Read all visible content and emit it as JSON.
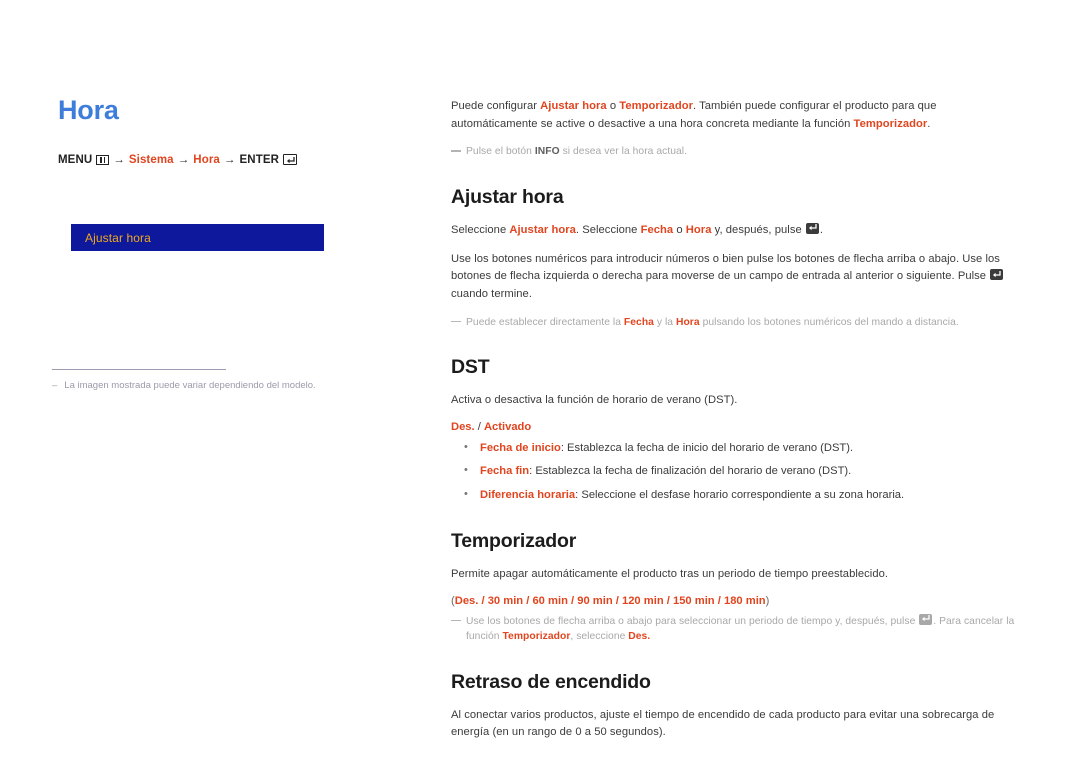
{
  "left": {
    "title": "Hora",
    "menu_path": {
      "menu_label": "MENU",
      "menu_icon": "menu-grid-icon",
      "arrow": "→",
      "step1": "Sistema",
      "step2": "Hora",
      "enter_label": "ENTER",
      "enter_icon": "enter-key-icon"
    },
    "osd_item": "Ajustar hora",
    "footnote_dash": "–",
    "footnote": "La imagen mostrada puede variar dependiendo del modelo."
  },
  "right": {
    "intro": {
      "a": "Puede configurar ",
      "b": "Ajustar hora",
      "c": " o ",
      "d": "Temporizador",
      "e": ". También puede configurar el producto para que automáticamente se active o desactive a una hora concreta mediante la función ",
      "f": "Temporizador",
      "g": "."
    },
    "intro_note": {
      "a": "Pulse el botón ",
      "b": "INFO",
      "c": " si desea ver la hora actual."
    },
    "ajustar_hora": {
      "heading": "Ajustar hora",
      "p1": {
        "a": "Seleccione ",
        "b": "Ajustar hora",
        "c": ". Seleccione ",
        "d": "Fecha",
        "e": " o ",
        "f": "Hora",
        "g": " y, después, pulse ",
        "h": "."
      },
      "p2": "Use los botones numéricos para introducir números o bien pulse los botones de flecha arriba o abajo. Use los botones de flecha izquierda o derecha para moverse de un campo de entrada al anterior o siguiente. Pulse ",
      "p2_tail": " cuando termine.",
      "note": {
        "a": "Puede establecer directamente la ",
        "b": "Fecha",
        "c": " y la ",
        "d": "Hora",
        "e": " pulsando los botones numéricos del mando a distancia."
      }
    },
    "dst": {
      "heading": "DST",
      "p1": "Activa o desactiva la función de horario de verano (DST).",
      "options": {
        "off": "Des.",
        "sep": " / ",
        "on": "Activado"
      },
      "bullets": [
        {
          "term": "Fecha de inicio",
          "desc": ": Establezca la fecha de inicio del horario de verano (DST)."
        },
        {
          "term": "Fecha fin",
          "desc": ": Establezca la fecha de finalización del horario de verano (DST)."
        },
        {
          "term": "Diferencia horaria",
          "desc": ": Seleccione el desfase horario correspondiente a su zona horaria."
        }
      ]
    },
    "temporizador": {
      "heading": "Temporizador",
      "p1": "Permite apagar automáticamente el producto tras un periodo de tiempo preestablecido.",
      "options_open": "(",
      "options": "Des. / 30 min / 60 min / 90 min / 120 min / 150 min / 180 min",
      "options_close": ")",
      "note": {
        "a": "Use los botones de flecha arriba o abajo para seleccionar un periodo de tiempo y, después, pulse ",
        "b": ". Para cancelar la función ",
        "c": "Temporizador",
        "d": ", seleccione ",
        "e": "Des.",
        "f": ""
      }
    },
    "retraso": {
      "heading": "Retraso de encendido",
      "p1": "Al conectar varios productos, ajuste el tiempo de encendido de cada producto para evitar una sobrecarga de energía (en un rango de 0 a 50 segundos)."
    }
  },
  "colors": {
    "title_blue": "#3f7ddb",
    "accent_red": "#e1451f",
    "osd_navy": "#0d189c",
    "osd_gold": "#f0a81e",
    "body_grey": "#3b3b3b",
    "note_grey": "#a8a8a8"
  }
}
